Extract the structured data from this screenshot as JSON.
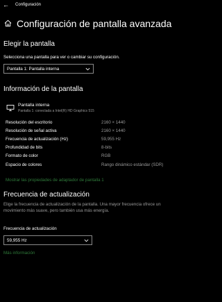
{
  "titlebar": {
    "back_icon": "back-arrow-icon",
    "title": "Configuración"
  },
  "header": {
    "home_icon": "home-icon",
    "title": "Configuración de pantalla avanzada"
  },
  "select_display": {
    "heading": "Elegir la pantalla",
    "description": "Selecciona una pantalla para ver o cambiar su configuración.",
    "selected": "Pantalla 1: Pantalla interna"
  },
  "display_info": {
    "heading": "Información de la pantalla",
    "monitor_icon": "monitor-icon",
    "display_name": "Pantalla interna",
    "display_sub": "Pantalla 1: conectada a Intel(R) HD Graphics 515",
    "rows": [
      {
        "label": "Resolución del escritorio",
        "value": "2160 × 1440"
      },
      {
        "label": "Resolución de señal activa",
        "value": "2160 × 1440"
      },
      {
        "label": "Frecuencia de actualización (Hz)",
        "value": "59,955 Hz"
      },
      {
        "label": "Profundidad de bits",
        "value": "8-bits"
      },
      {
        "label": "Formato de color",
        "value": "RGB"
      },
      {
        "label": "Espacio de colores",
        "value": "Rango dinámico estándar (SDR)"
      }
    ],
    "adapter_link": "Mostrar las propiedades de adaptador de pantalla 1"
  },
  "refresh": {
    "heading": "Frecuencia de actualización",
    "description": "Elige la frecuencia de actualización de la pantalla. Una mayor frecuencia ofrece un movimiento más suave, pero también usa más energía.",
    "field_label": "Frecuencia de actualización",
    "selected": "59,955 Hz",
    "more_link": "Más información"
  },
  "colors": {
    "background": "#000000",
    "text": "#ffffff",
    "secondary": "#9a9a9a",
    "link": "#2f7a3a",
    "border": "#8a8a8a"
  }
}
